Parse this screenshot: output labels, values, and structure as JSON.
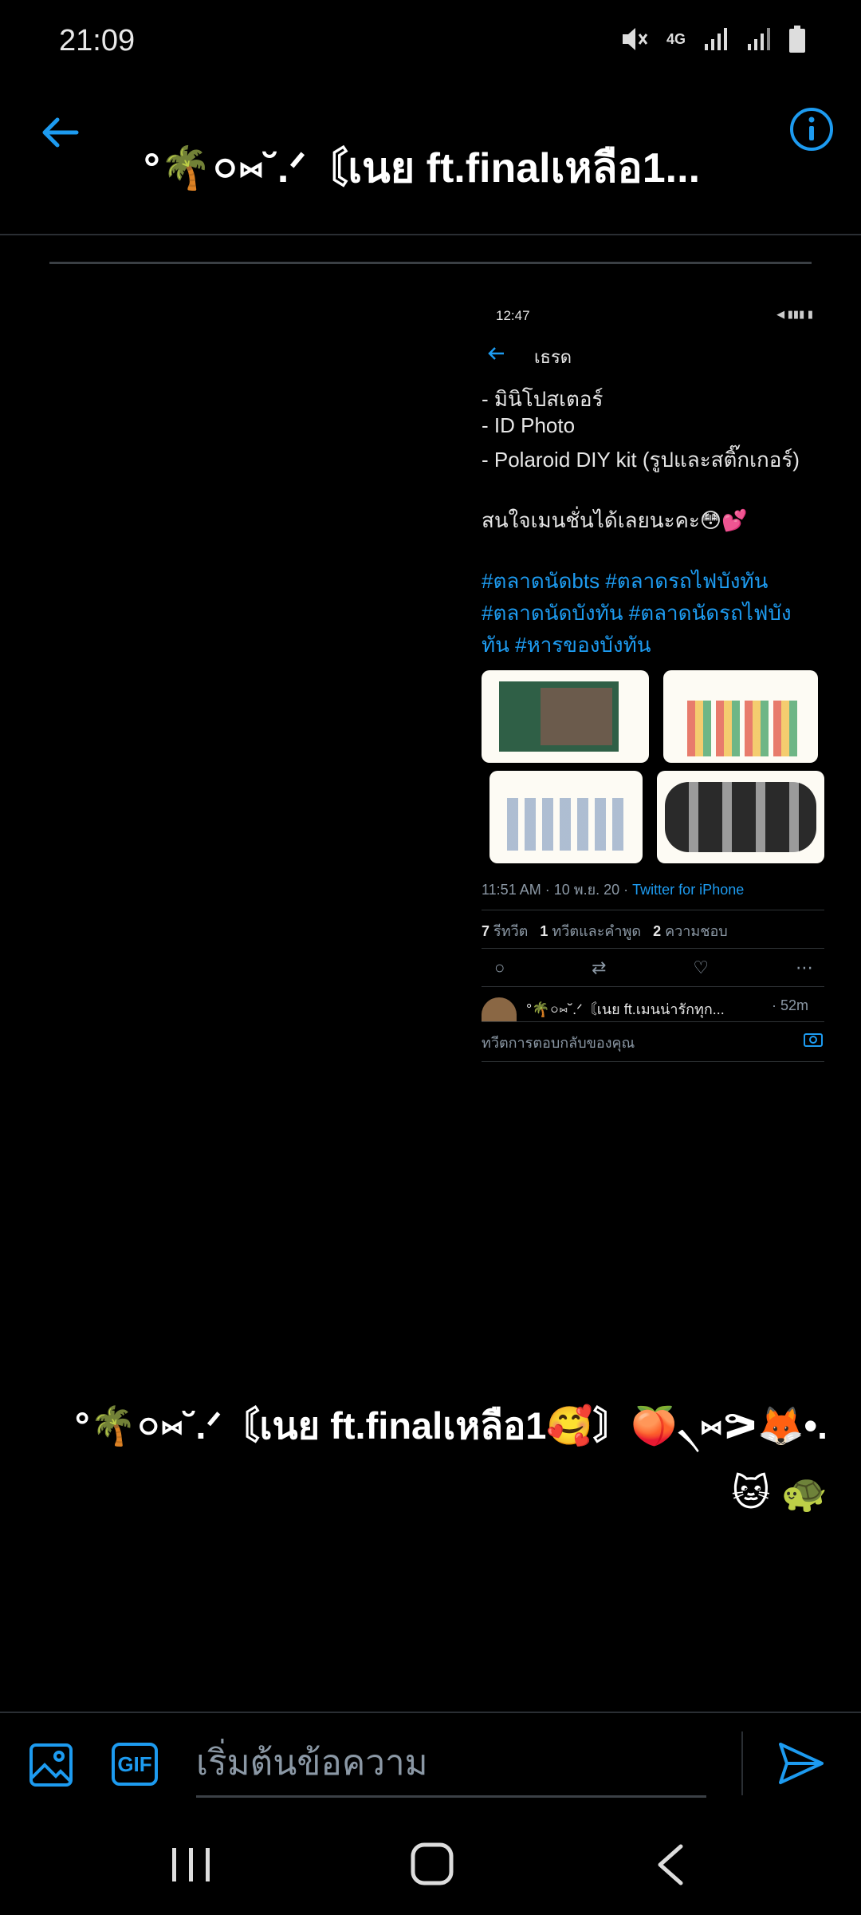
{
  "status_bar": {
    "time": "21:09",
    "network": "4G"
  },
  "header": {
    "title": "°🌴০⑅˘.ᐟ〘เนย ft.finalเหลือ1..."
  },
  "shared_image": {
    "status_time": "12:47",
    "nav_title": "เธรด",
    "lines": [
      "- มินิโปสเตอร์",
      "- ID Photo",
      "- Polaroid DIY kit (รูปและสติ๊กเกอร์)"
    ],
    "interest_text": "สนใจเมนชั่นได้เลยนะคะ😳💕",
    "hashtags": [
      "#ตลาดนัดbts #ตลาดรถไฟบังทัน",
      "#ตลาดนัดบังทัน #ตลาดนัดรถไฟบัง",
      "ทัน #หารของบังทัน"
    ],
    "meta_time": "11:51 AM · 10 พ.ย. 20 · ",
    "meta_source": "Twitter for iPhone",
    "stats": {
      "retweets": "7",
      "retweets_label": "รีทวีต",
      "quotes": "1",
      "quotes_label": "ทวีตและคำพูด",
      "likes": "2",
      "likes_label": "ความชอบ"
    },
    "reply_name": "°🌴০⑅˘.ᐟ〘เนย ft.เมนน่ารักทุก...",
    "reply_time": "· 52m",
    "reply_placeholder": "ทวีตการตอบกลับของคุณ"
  },
  "message": {
    "text": "°🌴০⑅˘.ᐟ〘เนย ft.finalเหลือ1🥰〙🍑৲⑅ᕗ🦊•.🐱 🐢"
  },
  "composer": {
    "placeholder": "เริ่มต้นข้อความ",
    "gif_label": "GIF"
  },
  "colors": {
    "accent": "#1d9bf0",
    "background": "#000000"
  }
}
